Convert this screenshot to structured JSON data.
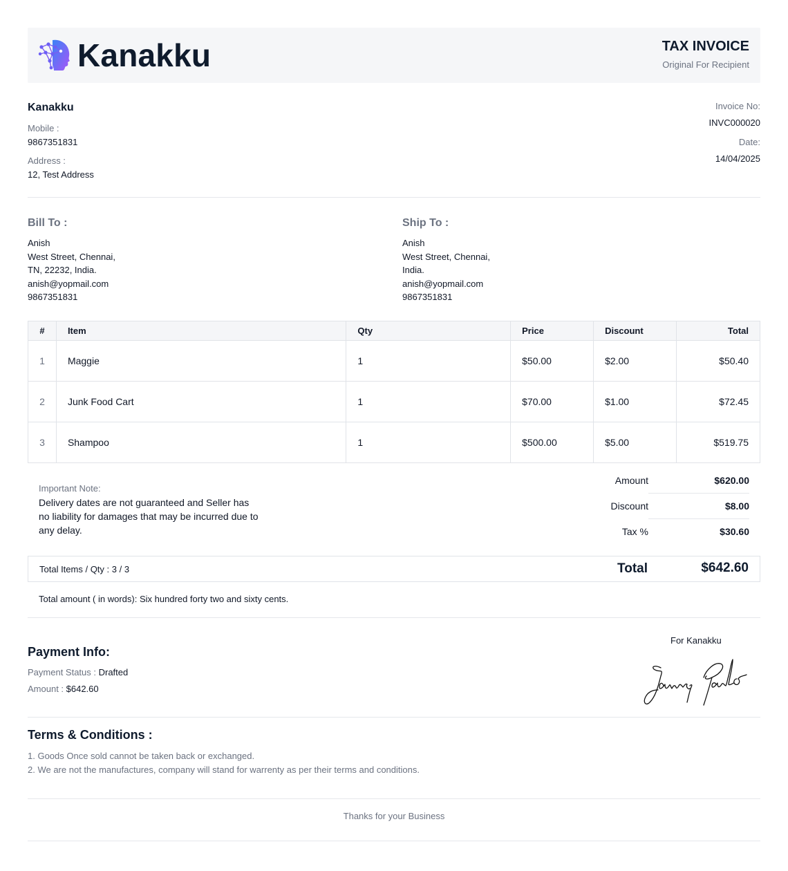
{
  "header": {
    "brand": "Kanakku",
    "doc_title": "TAX INVOICE",
    "doc_subtitle": "Original For Recipient"
  },
  "seller": {
    "name": "Kanakku",
    "mobile_label": "Mobile :",
    "mobile": "9867351831",
    "address_label": "Address :",
    "address": "12, Test Address"
  },
  "invoice": {
    "number_label": "Invoice No:",
    "number": "INVC000020",
    "date_label": "Date:",
    "date": "14/04/2025"
  },
  "bill_to": {
    "title": "Bill To :",
    "name": "Anish",
    "line1": "West Street, Chennai,",
    "line2": "TN, 22232, India.",
    "email": "anish@yopmail.com",
    "phone": "9867351831"
  },
  "ship_to": {
    "title": "Ship To :",
    "name": "Anish",
    "line1": "West Street, Chennai,",
    "line2": "India.",
    "email": "anish@yopmail.com",
    "phone": "9867351831"
  },
  "items_table": {
    "headers": [
      "#",
      "Item",
      "Qty",
      "Price",
      "Discount",
      "Total"
    ],
    "rows": [
      {
        "num": "1",
        "item": "Maggie",
        "qty": "1",
        "price": "$50.00",
        "discount": "$2.00",
        "total": "$50.40"
      },
      {
        "num": "2",
        "item": "Junk Food Cart",
        "qty": "1",
        "price": "$70.00",
        "discount": "$1.00",
        "total": "$72.45"
      },
      {
        "num": "3",
        "item": "Shampoo",
        "qty": "1",
        "price": "$500.00",
        "discount": "$5.00",
        "total": "$519.75"
      }
    ]
  },
  "note": {
    "label": "Important Note:",
    "text": "Delivery dates are not guaranteed and Seller has no liability for damages that may be incurred due to any delay."
  },
  "summary": {
    "amount_label": "Amount",
    "amount": "$620.00",
    "discount_label": "Discount",
    "discount": "$8.00",
    "tax_label": "Tax %",
    "tax": "$30.60",
    "total_items": "Total Items / Qty : 3 / 3",
    "total_label": "Total",
    "total": "$642.60",
    "words": "Total amount ( in words):  Six hundred forty two and sixty cents."
  },
  "payment": {
    "title": "Payment Info:",
    "status_label": "Payment Status : ",
    "status": "Drafted",
    "amount_label": "Amount : ",
    "amount": "$642.60"
  },
  "signature": {
    "for_label": "For Kanakku",
    "signer": "James Paulo"
  },
  "terms": {
    "title": "Terms & Conditions :",
    "items": [
      "1. Goods Once sold cannot be taken back or exchanged.",
      "2. We are not the manufactures, company will stand for warrenty as per their terms and conditions."
    ]
  },
  "footer": {
    "thanks": "Thanks for your Business"
  },
  "colors": {
    "brand_gradient_start": "#3b82f6",
    "brand_gradient_end": "#a855f7",
    "heading": "#0f1b2d",
    "muted": "#6b7280",
    "band": "#f5f6f8"
  },
  "icons": {
    "logo": "brain-network-head-icon"
  }
}
